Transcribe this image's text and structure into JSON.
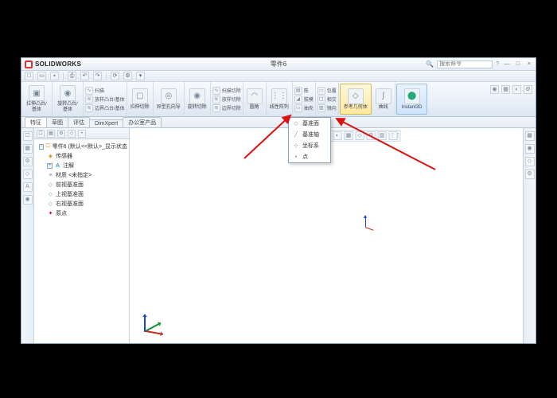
{
  "app": {
    "brand": "SOLIDWORKS",
    "document": "零件6"
  },
  "search": {
    "placeholder": "搜索命令"
  },
  "window_controls": {
    "min": "—",
    "max": "□",
    "close": "×"
  },
  "ribbon": {
    "extrude": "拉伸凸台/基体",
    "revolve": "旋转凸台/基体",
    "sweep": "扫描",
    "loft_boss": "放样凸台/基体",
    "boundary_boss": "边界凸台/基体",
    "cut_extrude": "拉伸切除",
    "hole_wizard": "异型孔向导",
    "cut_revolve": "旋转切除",
    "swept_cut": "扫描切除",
    "loft_cut": "放样切除",
    "boundary_cut": "边界切除",
    "fillet": "圆角",
    "pattern": "线性阵列",
    "rib": "筋",
    "draft": "拔模",
    "shell": "抽壳",
    "wrap": "包覆",
    "intersect": "相交",
    "mirror": "镜向",
    "ref_geom": "参考几何体",
    "curves": "曲线",
    "instant3d": "Instant3D"
  },
  "tabs": [
    "特征",
    "草图",
    "评估",
    "DimXpert",
    "办公室产品"
  ],
  "feature_tree": {
    "root": "零件6 (默认<<默认>_显示状态",
    "sensors": "传感器",
    "annotations": "注解",
    "material": "材质 <未指定>",
    "front_plane": "前视基准面",
    "top_plane": "上视基准面",
    "right_plane": "右视基准面",
    "origin": "原点"
  },
  "dropdown": {
    "plane": "基准面",
    "axis": "基准轴",
    "coord": "坐标系",
    "point": "点"
  },
  "icons": {
    "new": "□",
    "open": "▭",
    "save": "▪",
    "print": "⎙",
    "undo": "↶",
    "redo": "↷",
    "rebuild": "⟳",
    "options": "⚙",
    "dropdown": "▾",
    "extrude": "▣",
    "revolve": "◉",
    "sweep": "∿",
    "loft": "≋",
    "cut": "▢",
    "hole": "◎",
    "fillet": "◠",
    "pattern": "⋮⋮",
    "rib": "▤",
    "draft": "◢",
    "shell": "▭",
    "mirror": "▥",
    "refgeom": "◇",
    "curves": "∫",
    "instant": "⬤",
    "tree": "🞎",
    "sensor": "◈",
    "anno": "A",
    "material": "≡",
    "plane": "◇",
    "axis": "╱",
    "coord": "⊹",
    "point": "•",
    "origin": "✦",
    "view": "◉",
    "zoom": "⊕",
    "section": "◐",
    "display": "▦",
    "search": "🔍",
    "help": "?"
  }
}
